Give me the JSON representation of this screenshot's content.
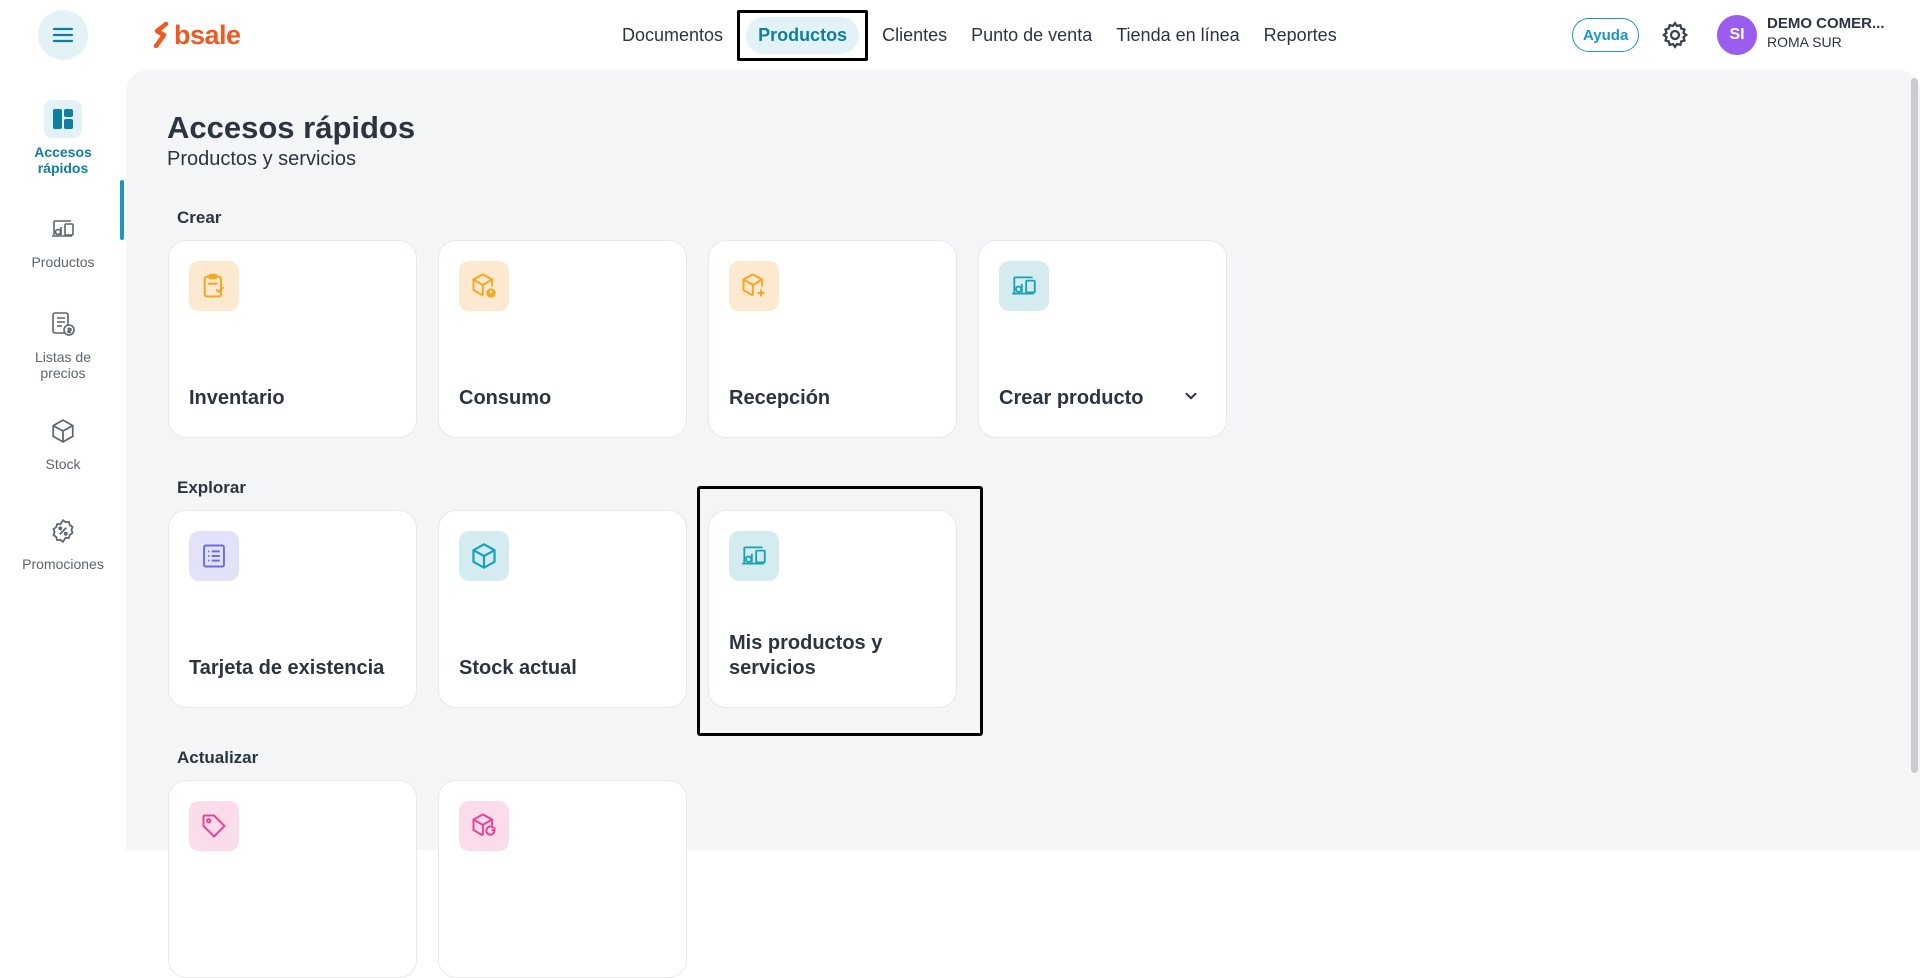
{
  "app": {
    "logo_text": "bsale",
    "brand_color": "#f05a22",
    "accent_color": "#1a97c1"
  },
  "topnav": {
    "items": [
      {
        "label": "Documentos"
      },
      {
        "label": "Productos"
      },
      {
        "label": "Clientes"
      },
      {
        "label": "Punto de venta"
      },
      {
        "label": "Tienda en línea"
      },
      {
        "label": "Reportes"
      }
    ],
    "active": "Productos",
    "help_label": "Ayuda",
    "avatar_initials": "SI",
    "company_name": "DEMO COMER...",
    "company_branch": "ROMA SUR"
  },
  "sidebar": {
    "items": [
      {
        "label_line1": "Accesos",
        "label_line2": "rápidos",
        "icon": "dashboard-icon"
      },
      {
        "label_line1": "Productos",
        "label_line2": "",
        "icon": "products-icon"
      },
      {
        "label_line1": "Listas de",
        "label_line2": "precios",
        "icon": "price-list-icon"
      },
      {
        "label_line1": "Stock",
        "label_line2": "",
        "icon": "box-icon"
      },
      {
        "label_line1": "Promociones",
        "label_line2": "",
        "icon": "discount-badge-icon"
      }
    ]
  },
  "page": {
    "title": "Accesos rápidos",
    "subtitle": "Productos y servicios"
  },
  "sections": {
    "crear": {
      "label": "Crear",
      "cards": [
        {
          "label": "Inventario",
          "icon": "clipboard-check-icon",
          "color": "#f5a623"
        },
        {
          "label": "Consumo",
          "icon": "box-alert-icon",
          "color": "#f5a623"
        },
        {
          "label": "Recepción",
          "icon": "box-plus-icon",
          "color": "#f5a623"
        },
        {
          "label": "Crear producto",
          "icon": "products-icon",
          "color": "#17a2b8"
        }
      ]
    },
    "explorar": {
      "label": "Explorar",
      "cards": [
        {
          "label": "Tarjeta de existencia",
          "icon": "list-card-icon",
          "color": "#6a6fe0"
        },
        {
          "label": "Stock actual",
          "icon": "cube-icon",
          "color": "#17a2b8"
        },
        {
          "label": "Mis productos y servicios",
          "icon": "products-icon",
          "color": "#17a2b8"
        }
      ]
    },
    "actualizar": {
      "label": "Actualizar",
      "cards": [
        {
          "label": "",
          "icon": "tag-icon",
          "color": "#e84393"
        },
        {
          "label": "",
          "icon": "box-refresh-icon",
          "color": "#e84393"
        }
      ]
    }
  }
}
